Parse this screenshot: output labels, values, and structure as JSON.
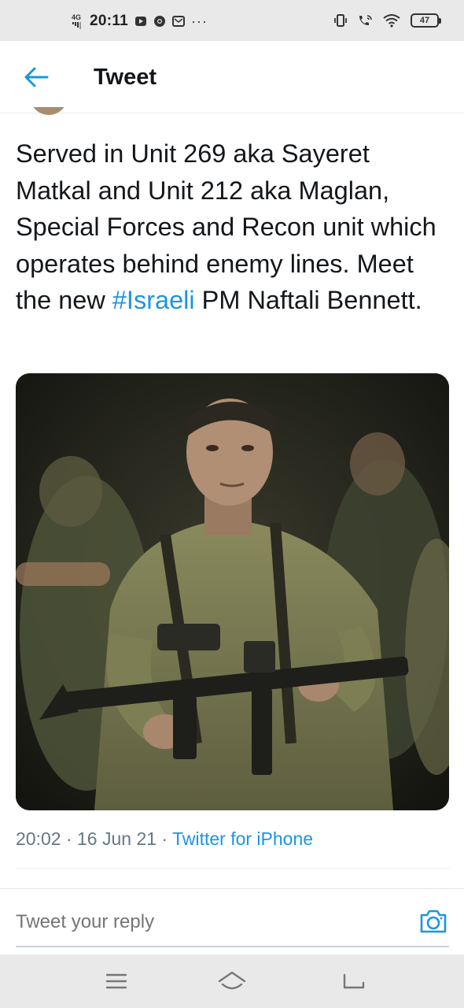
{
  "status_bar": {
    "network": "4G",
    "time": "20:11",
    "more": "···",
    "battery": "47",
    "icons": [
      "youtube-icon",
      "chrome-icon",
      "mail-icon",
      "vibrate-icon",
      "wifi-call-icon",
      "wifi-icon"
    ]
  },
  "header": {
    "title": "Tweet",
    "back_icon": "arrow-left-icon"
  },
  "tweet": {
    "text_before": "Served in Unit 269 aka Sayeret Matkal and Unit 212 aka Maglan, Special Forces and Recon unit which operates behind enemy lines. Meet the new ",
    "hashtag": "#Israeli",
    "text_after": " PM Naftali Bennett.",
    "time": "20:02",
    "separator": " · ",
    "date": "16 Jun 21",
    "separator2": " · ",
    "source": "Twitter for iPhone"
  },
  "reply": {
    "placeholder": "Tweet your reply",
    "camera_icon": "camera-icon"
  },
  "nav": {
    "icons": [
      "menu-icon",
      "home-icon",
      "back-icon"
    ]
  },
  "colors": {
    "accent": "#1b95e0",
    "text": "#14171a",
    "muted": "#657786",
    "bars": "#e9e9e9"
  }
}
